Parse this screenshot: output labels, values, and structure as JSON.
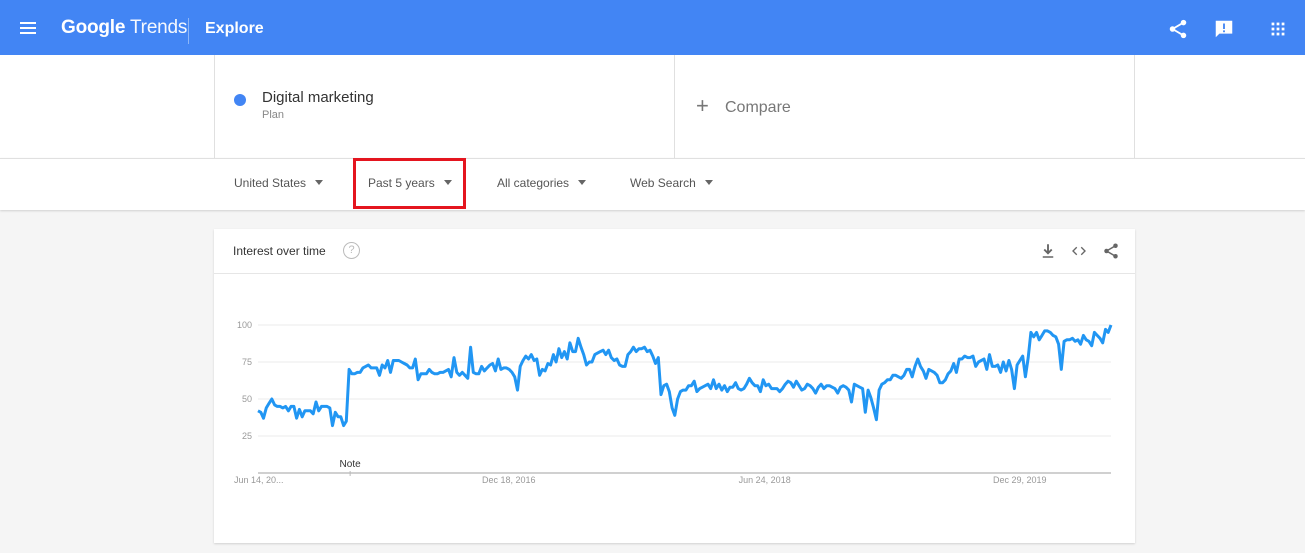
{
  "app": {
    "brand_bold": "Google",
    "brand_light": " Trends",
    "page": "Explore",
    "accent_color": "#4285f4",
    "icons": [
      "menu-icon",
      "share-icon",
      "feedback-icon",
      "apps-grid-icon"
    ]
  },
  "search": {
    "term": "Digital marketing",
    "term_type": "Plan",
    "term_color": "#4285f4",
    "compare_label": "Compare"
  },
  "filters": {
    "region": "United States",
    "time_range": "Past 5 years",
    "category": "All categories",
    "search_type": "Web Search",
    "highlight_color": "#e4151f"
  },
  "card": {
    "title": "Interest over time",
    "help_icon": "?",
    "icons": [
      "download-icon",
      "embed-icon",
      "share-icon"
    ]
  },
  "chart_data": {
    "type": "line",
    "title": "Interest over time",
    "xlabel": "",
    "ylabel": "",
    "ylim": [
      0,
      100
    ],
    "yticks": [
      25,
      50,
      75,
      100
    ],
    "ytick_labels": [
      "25",
      "50",
      "75",
      "100"
    ],
    "xtick_labels": [
      "Jun 14, 20...",
      "Dec 18, 2016",
      "Jun 24, 2018",
      "Dec 29, 2019"
    ],
    "xtick_positions": [
      0,
      0.294,
      0.594,
      0.893
    ],
    "grid": true,
    "legend": "none",
    "annotation": {
      "label": "Note",
      "position": 0.108
    },
    "series": [
      {
        "name": "Digital marketing",
        "color": "#2196f3",
        "values": [
          42,
          41,
          37,
          44,
          47,
          50,
          46,
          45,
          45,
          44,
          45,
          42,
          45,
          45,
          37,
          43,
          38,
          42,
          42,
          42,
          40,
          48,
          42,
          45,
          45,
          45,
          44,
          32,
          41,
          38,
          38,
          32,
          35,
          70,
          67,
          67,
          68,
          68,
          71,
          72,
          73,
          71,
          71,
          71,
          66,
          73,
          71,
          76,
          68,
          76,
          76,
          76,
          75,
          74,
          73,
          71,
          71,
          77,
          63,
          67,
          67,
          67,
          70,
          68,
          67,
          67,
          68,
          68,
          69,
          70,
          65,
          78,
          68,
          66,
          68,
          66,
          64,
          85,
          68,
          67,
          67,
          72,
          69,
          71,
          73,
          74,
          69,
          77,
          70,
          71,
          71,
          70,
          68,
          65,
          56,
          72,
          76,
          79,
          77,
          80,
          76,
          77,
          66,
          70,
          69,
          74,
          73,
          80,
          75,
          84,
          78,
          82,
          77,
          88,
          82,
          82,
          91,
          85,
          80,
          73,
          75,
          75,
          80,
          81,
          82,
          83,
          80,
          83,
          78,
          76,
          77,
          73,
          72,
          72,
          80,
          82,
          85,
          82,
          84,
          84,
          85,
          82,
          83,
          79,
          74,
          78,
          53,
          59,
          60,
          55,
          44,
          39,
          50,
          55,
          56,
          56,
          59,
          59,
          62,
          55,
          57,
          58,
          59,
          60,
          57,
          63,
          57,
          60,
          56,
          59,
          55,
          58,
          58,
          61,
          57,
          56,
          57,
          60,
          64,
          61,
          59,
          59,
          55,
          63,
          59,
          60,
          57,
          57,
          57,
          55,
          57,
          60,
          62,
          61,
          58,
          62,
          59,
          56,
          57,
          60,
          59,
          57,
          54,
          58,
          60,
          57,
          59,
          59,
          58,
          57,
          54,
          58,
          59,
          58,
          56,
          48,
          60,
          59,
          58,
          57,
          41,
          56,
          51,
          44,
          36,
          56,
          60,
          61,
          63,
          63,
          66,
          66,
          65,
          64,
          66,
          70,
          70,
          65,
          72,
          77,
          72,
          69,
          64,
          70,
          69,
          68,
          66,
          61,
          61,
          63,
          67,
          69,
          74,
          68,
          77,
          77,
          79,
          78,
          78,
          79,
          72,
          75,
          76,
          77,
          70,
          80,
          72,
          72,
          73,
          68,
          75,
          69,
          76,
          70,
          57,
          73,
          76,
          79,
          65,
          78,
          95,
          92,
          95,
          90,
          93,
          96,
          96,
          95,
          93,
          92,
          87,
          70,
          89,
          90,
          90,
          91,
          89,
          90,
          87,
          93,
          90,
          89,
          86,
          95,
          93,
          91,
          88,
          97,
          95,
          100
        ]
      }
    ]
  }
}
